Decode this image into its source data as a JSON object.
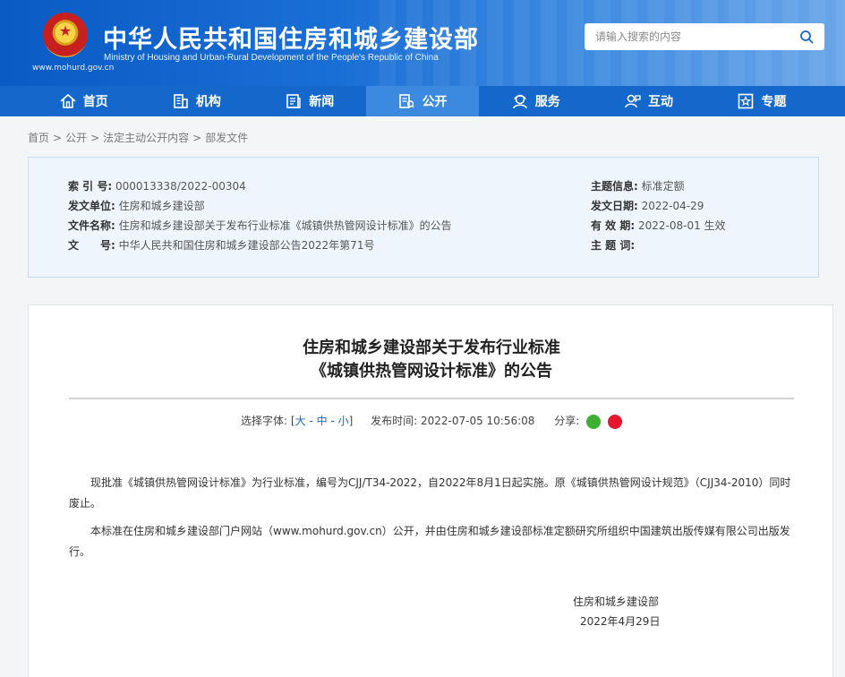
{
  "header": {
    "title": "中华人民共和国住房和城乡建设部",
    "subtitle": "Ministry of Housing and Urban-Rural Development of the People's Republic of China",
    "url": "www.mohurd.gov.cn",
    "search_placeholder": "请输入搜索的内容"
  },
  "nav": {
    "items": [
      {
        "label": "首页",
        "icon": "home-icon"
      },
      {
        "label": "机构",
        "icon": "building-icon"
      },
      {
        "label": "新闻",
        "icon": "news-icon"
      },
      {
        "label": "公开",
        "icon": "document-icon",
        "active": true
      },
      {
        "label": "服务",
        "icon": "service-icon"
      },
      {
        "label": "互动",
        "icon": "interaction-icon"
      },
      {
        "label": "专题",
        "icon": "star-icon"
      }
    ]
  },
  "breadcrumb": [
    "首页",
    "公开",
    "法定主动公开内容",
    "部发文件"
  ],
  "meta": {
    "index_label": "索 引 号:",
    "index_value": "000013338/2022-00304",
    "issuer_label": "发文单位:",
    "issuer_value": "住房和城乡建设部",
    "name_label": "文件名称:",
    "name_value": "住房和城乡建设部关于发布行业标准《城镇供热管网设计标准》的公告",
    "doc_label": "文　　号:",
    "doc_value": "中华人民共和国住房和城乡建设部公告2022年第71号",
    "topic_label": "主题信息:",
    "topic_value": "标准定额",
    "date_label": "发文日期:",
    "date_value": "2022-04-29",
    "valid_label": "有 效 期:",
    "valid_value": "2022-08-01 生效",
    "keywords_label": "主 题 词:",
    "keywords_value": ""
  },
  "article": {
    "title_line1": "住房和城乡建设部关于发布行业标准",
    "title_line2": "《城镇供热管网设计标准》的公告",
    "font_label": "选择字体: [",
    "font_large": "大",
    "font_medium": "中",
    "font_small": "小",
    "font_close": "]",
    "publish_label": "发布时间:",
    "publish_value": "2022-07-05 10:56:08",
    "share_label": "分享:",
    "para1": "现批准《城镇供热管网设计标准》为行业标准，编号为CJJ/T34-2022，自2022年8月1日起实施。原《城镇供热管网设计规范》（CJJ34-2010）同时废止。",
    "para2": "本标准在住房和城乡建设部门户网站（www.mohurd.gov.cn）公开，并由住房和城乡建设部标准定额研究所组织中国建筑出版传媒有限公司出版发行。",
    "signer": "住房和城乡建设部",
    "sign_date": "2022年4月29日"
  },
  "colors": {
    "header_blue": "#0a5bc4",
    "nav_blue": "#1468cc",
    "nav_active": "#3b8ae0",
    "meta_bg": "#eef5fd"
  }
}
